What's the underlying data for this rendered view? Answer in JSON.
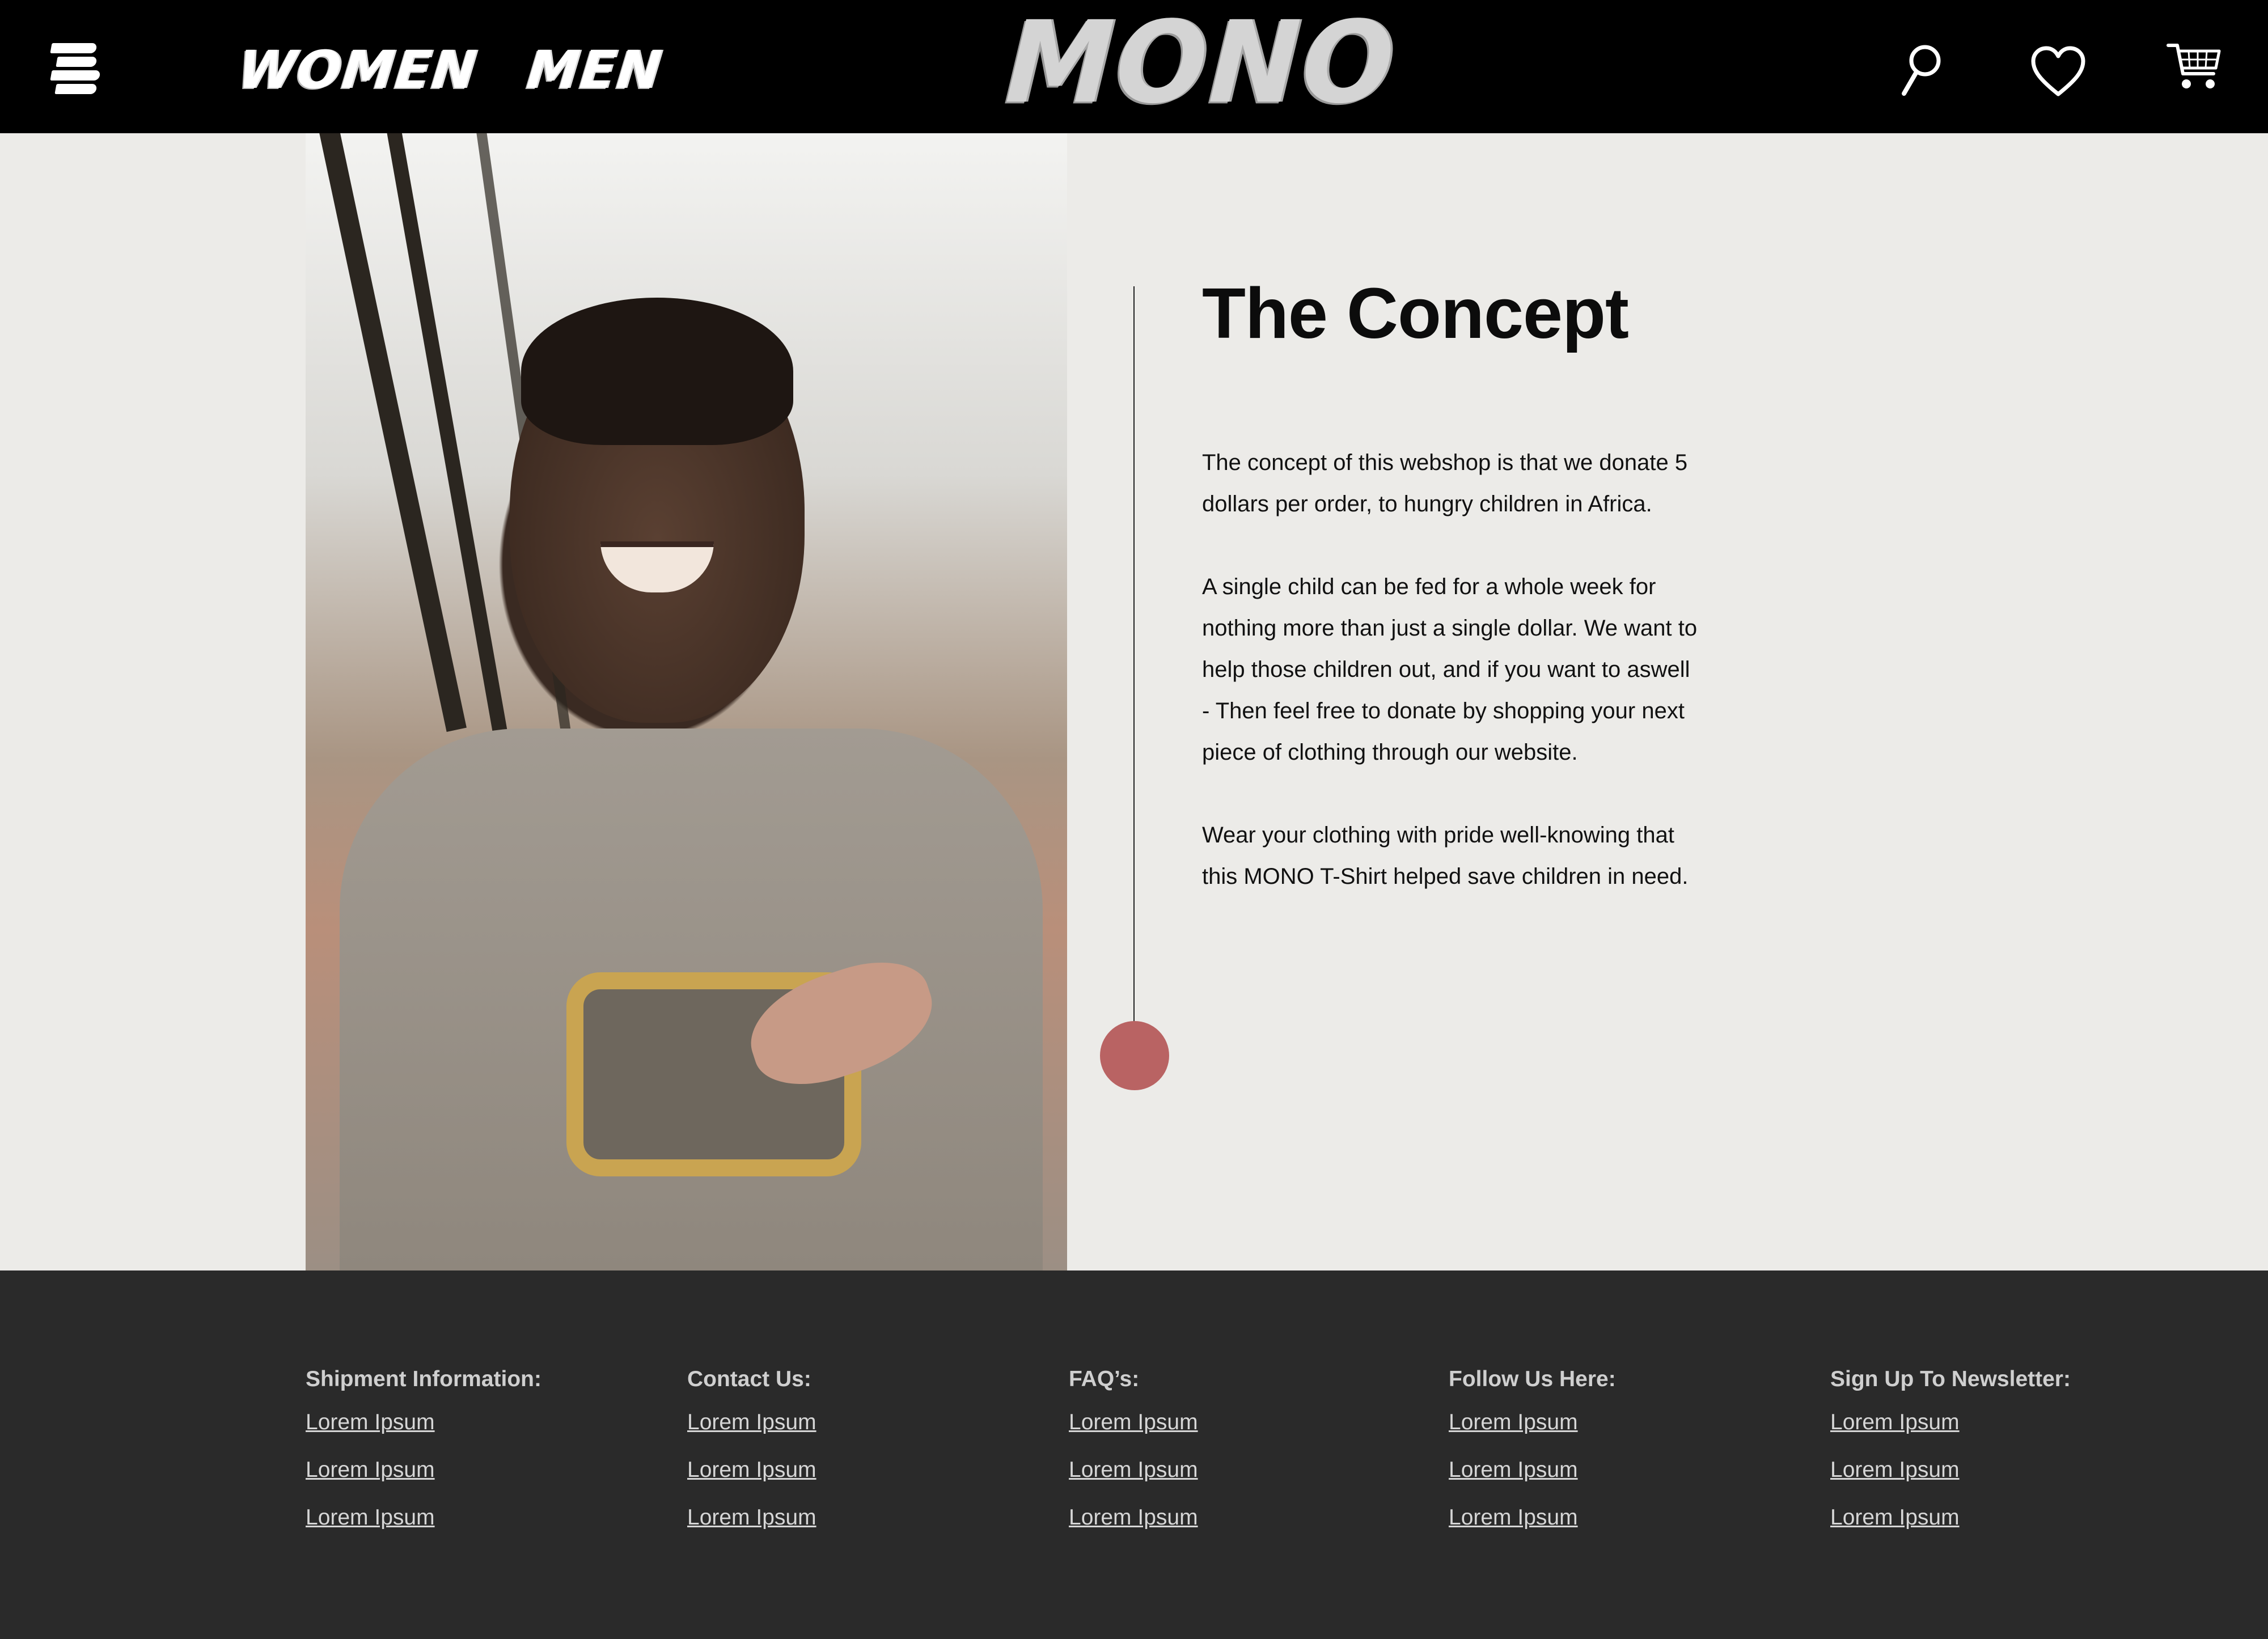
{
  "header": {
    "brand": "MONO",
    "nav": [
      "WOMEN",
      "MEN"
    ],
    "icons": [
      "menu-icon",
      "search-icon",
      "heart-icon",
      "cart-icon"
    ]
  },
  "hero": {
    "title": "The Concept",
    "paragraphs": [
      "The concept of this webshop is that we donate 5 dollars per order, to hungry children in Africa.",
      "A single child can be fed for a whole week for nothing more than just a single dollar. We want to help those children out, and if you want to aswell - Then feel free to donate by shopping your next piece of clothing through our website.",
      "Wear your clothing with pride well-knowing that this MONO T-Shirt helped save children in need."
    ],
    "accent_color": "#b96363"
  },
  "footer": {
    "columns": [
      {
        "title": "Shipment Information:",
        "links": [
          "Lorem Ipsum",
          "Lorem Ipsum",
          "Lorem Ipsum"
        ]
      },
      {
        "title": "Contact Us:",
        "links": [
          "Lorem Ipsum",
          "Lorem Ipsum",
          "Lorem Ipsum"
        ]
      },
      {
        "title": "FAQ’s:",
        "links": [
          "Lorem Ipsum",
          "Lorem Ipsum",
          "Lorem Ipsum"
        ]
      },
      {
        "title": "Follow Us Here:",
        "links": [
          "Lorem Ipsum",
          "Lorem Ipsum",
          "Lorem Ipsum"
        ]
      },
      {
        "title": "Sign Up To Newsletter:",
        "links": [
          "Lorem Ipsum",
          "Lorem Ipsum",
          "Lorem Ipsum"
        ]
      }
    ]
  }
}
